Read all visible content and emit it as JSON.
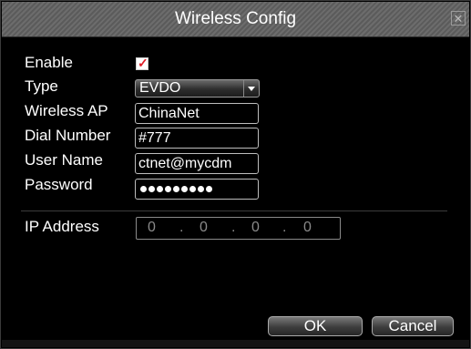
{
  "window": {
    "title": "Wireless Config",
    "close_glyph": "✕"
  },
  "form": {
    "enable_label": "Enable",
    "enable_checked": true,
    "type_label": "Type",
    "type_value": "EVDO",
    "ap_label": "Wireless AP",
    "ap_value": "ChinaNet",
    "dial_label": "Dial Number",
    "dial_value": "#777",
    "user_label": "User Name",
    "user_value": "ctnet@mycdm",
    "password_label": "Password",
    "password_dots": 9,
    "ip_label": "IP Address",
    "ip_octets": [
      "0",
      "0",
      "0",
      "0"
    ],
    "ip_separator": "."
  },
  "buttons": {
    "ok": "OK",
    "cancel": "Cancel"
  },
  "colors": {
    "accent_check": "#e0202a",
    "title_bar": "#6c6c6c"
  }
}
